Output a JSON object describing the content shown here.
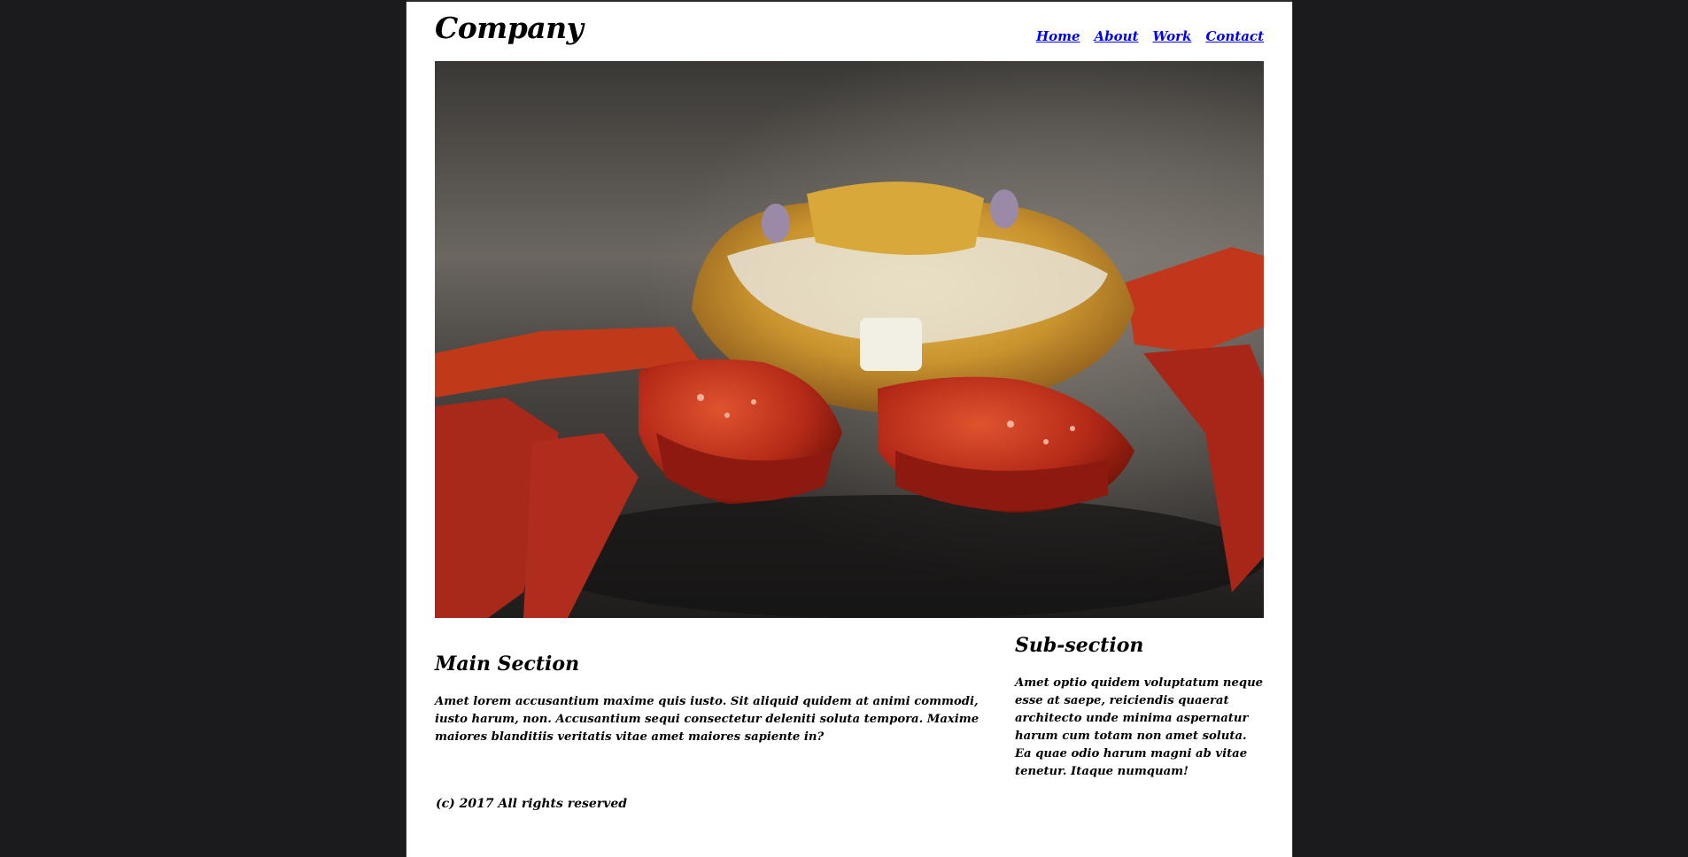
{
  "header": {
    "logo": "Company",
    "nav": [
      "Home",
      "About",
      "Work",
      "Contact"
    ]
  },
  "hero": {
    "image_subject": "crab-photo"
  },
  "main_section": {
    "title": "Main Section",
    "body": "Amet lorem accusantium maxime quis iusto. Sit aliquid quidem at animi commodi, iusto harum, non. Accusantium sequi consectetur deleniti soluta tempora. Maxime maiores blanditiis veritatis vitae amet maiores sapiente in?"
  },
  "sub_section": {
    "title": "Sub-section",
    "body": "Amet optio quidem voluptatum neque esse at saepe, reiciendis quaerat architecto unde minima aspernatur harum cum totam non amet soluta. Ea quae odio harum magni ab vitae tenetur. Itaque numquam!"
  },
  "footer": {
    "text": "(c) 2017 All rights reserved"
  },
  "colors": {
    "page_background": "#1b1b1d",
    "content_background": "#ffffff",
    "link": "#0000ee"
  }
}
